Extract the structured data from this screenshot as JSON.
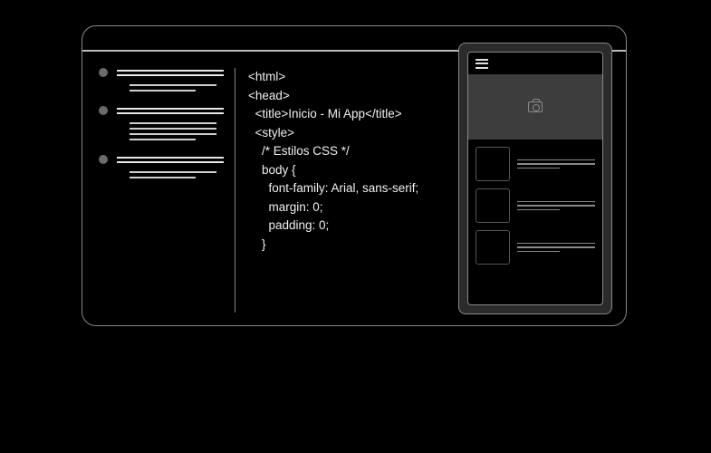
{
  "code": {
    "lines": [
      "<html>",
      "<head>",
      "  <title>Inicio - Mi App</title>",
      "  <style>",
      "    /* Estilos CSS */",
      "    body {",
      "      font-family: Arial, sans-serif;",
      "      margin: 0;",
      "      padding: 0;",
      "    }"
    ]
  }
}
